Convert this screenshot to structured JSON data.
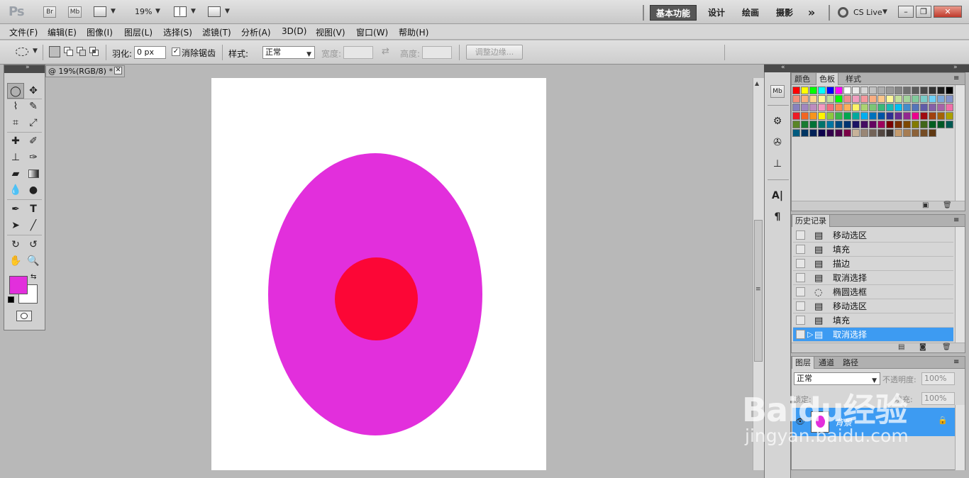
{
  "app": {
    "logo": "Ps",
    "launchers": [
      "Br",
      "Mb"
    ],
    "zoom": "19%"
  },
  "workspaces": [
    {
      "label": "基本功能",
      "active": true
    },
    {
      "label": "设计",
      "active": false
    },
    {
      "label": "绘画",
      "active": false
    },
    {
      "label": "摄影",
      "active": false
    }
  ],
  "more_workspaces": "»",
  "cslive": "CS Live",
  "window_buttons": [
    "–",
    "❐",
    "✕"
  ],
  "menu": [
    "文件(F)",
    "编辑(E)",
    "图像(I)",
    "图层(L)",
    "选择(S)",
    "滤镜(T)",
    "分析(A)",
    "3D(D)",
    "视图(V)",
    "窗口(W)",
    "帮助(H)"
  ],
  "options": {
    "feather_label": "羽化:",
    "feather_value": "0 px",
    "antialias_label": "消除锯齿",
    "antialias_checked": true,
    "style_label": "样式:",
    "style_value": "正常",
    "width_label": "宽度:",
    "height_label": "高度:",
    "refine_button": "调整边缘..."
  },
  "document": {
    "tab_title": "@ 19%(RGB/8) *",
    "fill_outer": "#e22fdc",
    "fill_inner": "#fc0636"
  },
  "colors": {
    "foreground": "#e22fdc",
    "background": "#ffffff"
  },
  "swatches_panel": {
    "tabs": [
      "颜色",
      "色板",
      "样式"
    ],
    "active_tab": "色板",
    "swatches": [
      "#ff0000",
      "#ffff00",
      "#00ff00",
      "#00ffff",
      "#0000ff",
      "#ff00ff",
      "#ffffff",
      "#ebebeb",
      "#d6d6d6",
      "#c2c2c2",
      "#adadad",
      "#999999",
      "#858585",
      "#707070",
      "#5c5c5c",
      "#474747",
      "#333333",
      "#1f1f1f",
      "#000000",
      "#f2917c",
      "#f7ae80",
      "#fcd58d",
      "#fff699",
      "#c4df9b",
      "#00ff00",
      "#ef8c8f",
      "#f19dbf",
      "#f5989d",
      "#f9ad81",
      "#fdc68a",
      "#fff79a",
      "#c4df9b",
      "#a3d39c",
      "#82ca9c",
      "#7accc8",
      "#6dcff6",
      "#7da7d9",
      "#8393ca",
      "#8781bd",
      "#a186be",
      "#bd8cbf",
      "#f49ac1",
      "#f26d7d",
      "#f68e55",
      "#fbaf5c",
      "#fff467",
      "#acd372",
      "#7cc576",
      "#3bb878",
      "#1abbb4",
      "#00bff3",
      "#438ccb",
      "#5574b9",
      "#605ca8",
      "#855fa8",
      "#a763a8",
      "#f06ea9",
      "#ed1c24",
      "#f26522",
      "#f7941d",
      "#fff200",
      "#8dc73f",
      "#39b54a",
      "#00a651",
      "#00a99d",
      "#00aeef",
      "#0072bc",
      "#0054a6",
      "#2e3192",
      "#662d91",
      "#92278f",
      "#ec008c",
      "#9e0b0f",
      "#a0410d",
      "#a36209",
      "#aba000",
      "#598527",
      "#1a7b30",
      "#007236",
      "#00746b",
      "#0076a3",
      "#004b80",
      "#003471",
      "#1b1464",
      "#440e62",
      "#630460",
      "#9e005d",
      "#790000",
      "#7b2e00",
      "#7d4900",
      "#827b00",
      "#406618",
      "#005e20",
      "#005826",
      "#005952",
      "#005b7f",
      "#003663",
      "#002157",
      "#0d004c",
      "#32004b",
      "#4b0049",
      "#7b0046",
      "#c7b299",
      "#998675",
      "#736357",
      "#534741",
      "#37302d",
      "#c69c6d",
      "#a67c52",
      "#8c6239",
      "#754c24",
      "#603913"
    ]
  },
  "history_panel": {
    "tab": "历史记录",
    "items": [
      {
        "label": "移动选区",
        "icon": "move-selection-icon",
        "selected": false
      },
      {
        "label": "填充",
        "icon": "fill-icon",
        "selected": false
      },
      {
        "label": "描边",
        "icon": "stroke-icon",
        "selected": false
      },
      {
        "label": "取消选择",
        "icon": "deselect-icon",
        "selected": false
      },
      {
        "label": "椭圆选框",
        "icon": "ellipse-marquee-icon",
        "selected": false
      },
      {
        "label": "移动选区",
        "icon": "move-selection-icon",
        "selected": false
      },
      {
        "label": "填充",
        "icon": "fill-icon",
        "selected": false
      },
      {
        "label": "取消选择",
        "icon": "deselect-icon",
        "selected": true
      }
    ]
  },
  "layers_panel": {
    "tabs": [
      "图层",
      "通道",
      "路径"
    ],
    "blend_mode": "正常",
    "opacity_label": "不透明度:",
    "opacity_value": "100%",
    "fill_label": "填充:",
    "fill_value": "100%",
    "lock_label": "锁定:",
    "layer_name": "背景"
  },
  "watermark": {
    "logo": "Baidu经验",
    "url": "jingyan.baidu.com"
  }
}
